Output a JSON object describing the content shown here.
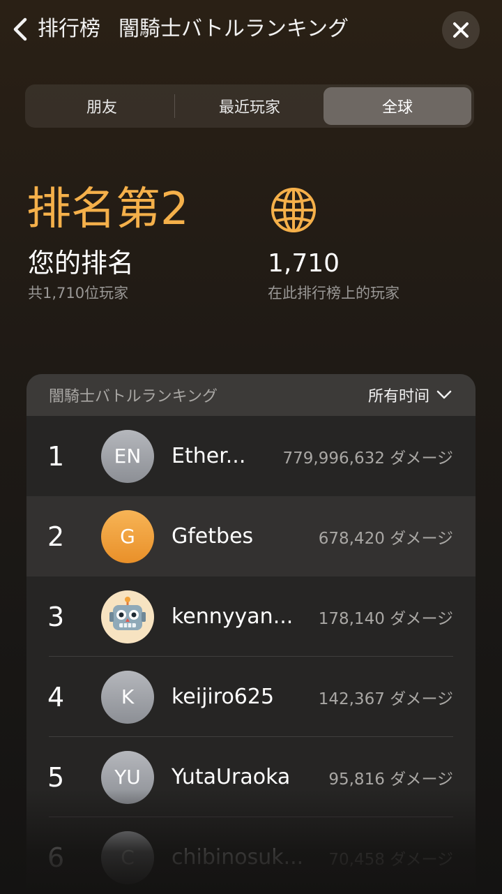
{
  "header": {
    "back_label": "排行榜",
    "game_title": "闇騎士バトルランキング"
  },
  "tabs": [
    {
      "label": "朋友",
      "active": false
    },
    {
      "label": "最近玩家",
      "active": false
    },
    {
      "label": "全球",
      "active": true
    }
  ],
  "stats": {
    "rank_big": "排名第2",
    "rank_label": "您的排名",
    "rank_sub": "共1,710位玩家",
    "player_count": "1,710",
    "player_count_sub": "在此排行榜上的玩家"
  },
  "leaderboard": {
    "title": "闇騎士バトルランキング",
    "filter": "所有时间",
    "rows": [
      {
        "rank": "1",
        "avatar": "EN",
        "name": "Ether...",
        "score": "779,996,632 ダメージ"
      },
      {
        "rank": "2",
        "avatar": "G",
        "name": "Gfetbes",
        "score": "678,420 ダメージ"
      },
      {
        "rank": "3",
        "avatar": "robot-icon",
        "name": "kennyyan...",
        "score": "178,140 ダメージ"
      },
      {
        "rank": "4",
        "avatar": "K",
        "name": "keijiro625",
        "score": "142,367 ダメージ"
      },
      {
        "rank": "5",
        "avatar": "YU",
        "name": "YutaUraoka",
        "score": "95,816 ダメージ"
      },
      {
        "rank": "6",
        "avatar": "C",
        "name": "chibinosuk...",
        "score": "70,458 ダメージ"
      }
    ]
  },
  "colors": {
    "accent": "#f5b04a",
    "highlight_avatar": "#f0a03d"
  }
}
